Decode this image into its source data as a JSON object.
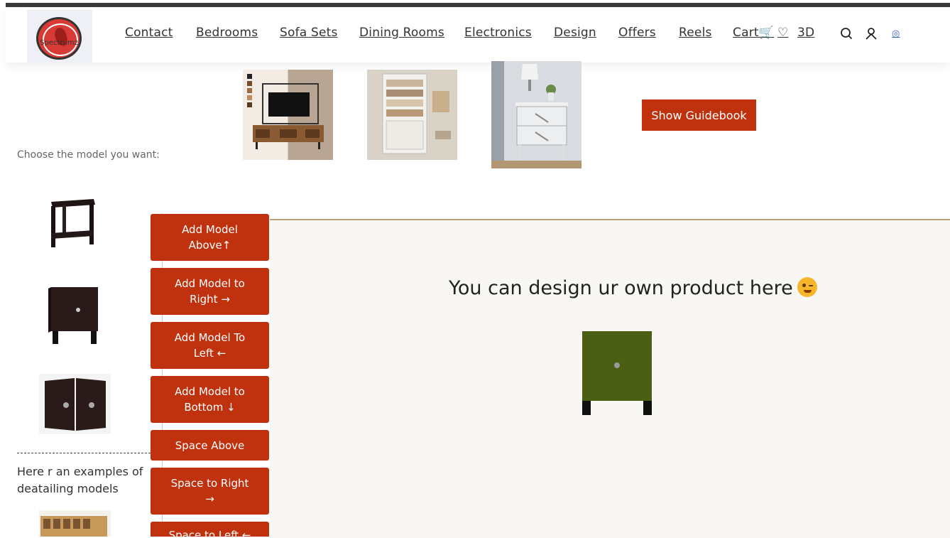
{
  "header": {
    "logo_text": "Spectrumz",
    "nav": [
      {
        "label": "Contact"
      },
      {
        "label": "Bedrooms"
      },
      {
        "label": "Sofa Sets"
      },
      {
        "label": "Dining Rooms"
      },
      {
        "label": "Electronics"
      },
      {
        "label": "Design"
      },
      {
        "label": "Offers"
      },
      {
        "label": "Reels"
      },
      {
        "label": "Cart🛒"
      },
      {
        "label": "♡"
      },
      {
        "label": "3D"
      }
    ],
    "account_link": "◎",
    "icons": [
      "search-icon",
      "user-icon"
    ]
  },
  "guide_button": "Show Guidebook",
  "choose_label": "Choose the model you want:",
  "main": {
    "title": "You can design ur own product here",
    "emoji": "winking-face-icon",
    "cabinet_color": "#4a5f14"
  },
  "side_buttons": [
    "Add Model\nAbove↑",
    "Add Model to\nRight →",
    "Add Model To\nLeft ←",
    "Add Model to\nBottom ↓",
    "Space Above",
    "Space to Right\n→",
    "Space to Left ←"
  ],
  "examples_text": "Here r an examples of deatailing models",
  "colors": {
    "accent": "#c0310e",
    "canvas_bg": "#f8f7f4",
    "divider": "#b5a27c"
  }
}
